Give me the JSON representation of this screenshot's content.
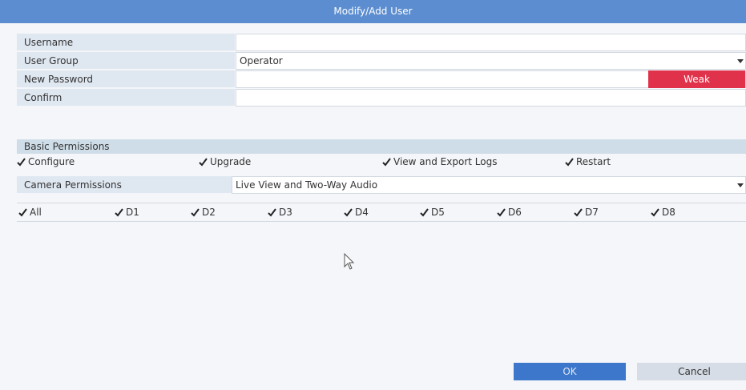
{
  "dialog": {
    "title": "Modify/Add User"
  },
  "form": {
    "username_label": "Username",
    "username_value": "",
    "user_group_label": "User Group",
    "user_group_value": "Operator",
    "new_password_label": "New Password",
    "password_strength": "Weak",
    "confirm_label": "Confirm"
  },
  "basic_permissions": {
    "heading": "Basic Permissions",
    "items": [
      {
        "label": "Configure",
        "checked": true
      },
      {
        "label": "Upgrade",
        "checked": true
      },
      {
        "label": "View and Export Logs",
        "checked": true
      },
      {
        "label": "Restart",
        "checked": true
      }
    ]
  },
  "camera_permissions": {
    "label": "Camera Permissions",
    "value": "Live View and Two-Way Audio",
    "channels": [
      {
        "label": "All",
        "checked": true
      },
      {
        "label": "D1",
        "checked": true
      },
      {
        "label": "D2",
        "checked": true
      },
      {
        "label": "D3",
        "checked": true
      },
      {
        "label": "D4",
        "checked": true
      },
      {
        "label": "D5",
        "checked": true
      },
      {
        "label": "D6",
        "checked": true
      },
      {
        "label": "D7",
        "checked": true
      },
      {
        "label": "D8",
        "checked": true
      }
    ]
  },
  "buttons": {
    "ok_label": "OK",
    "cancel_label": "Cancel"
  },
  "colors": {
    "title_bar": "#5b8dd0",
    "weak_badge": "#e0334b",
    "ok_button": "#3d77cc"
  }
}
